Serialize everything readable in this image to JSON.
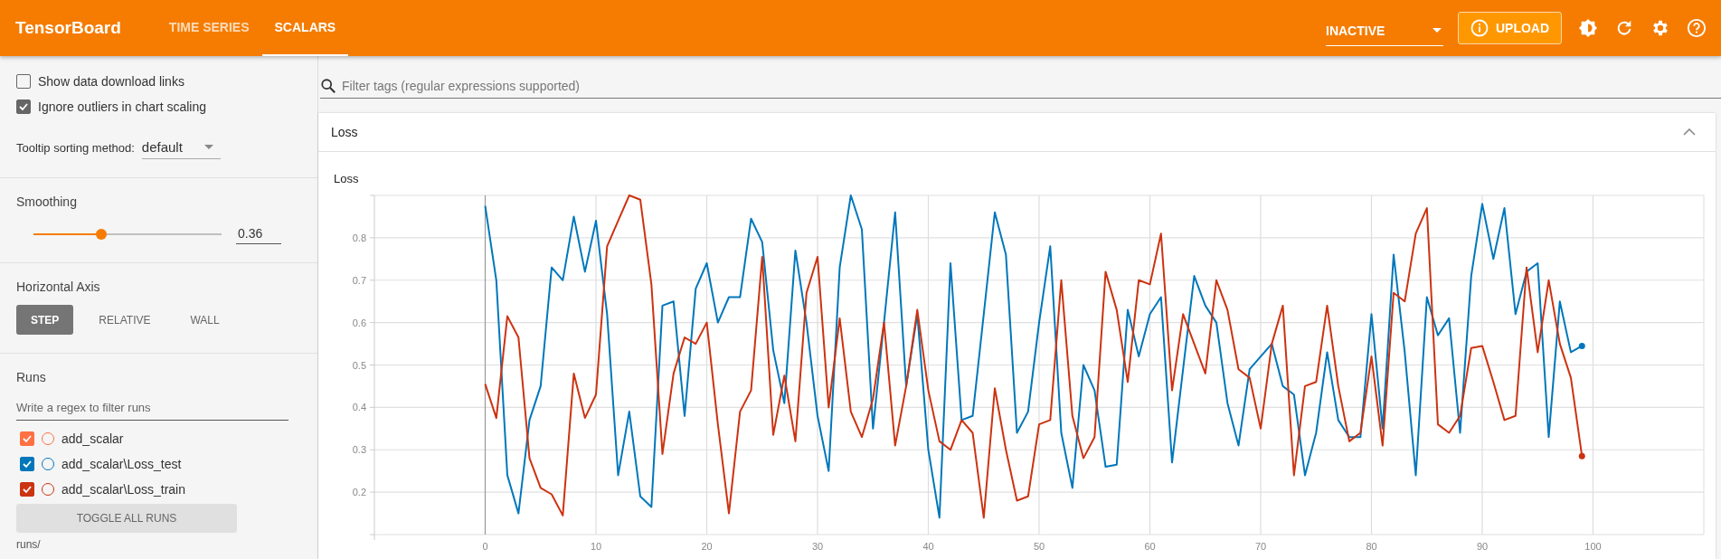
{
  "header": {
    "title": "TensorBoard",
    "tabs": [
      {
        "label": "TIME SERIES",
        "selected": false
      },
      {
        "label": "SCALARS",
        "selected": true
      }
    ],
    "reload_status": "INACTIVE",
    "upload_label": "UPLOAD"
  },
  "sidebar": {
    "options": [
      {
        "label": "Show data download links",
        "checked": false
      },
      {
        "label": "Ignore outliers in chart scaling",
        "checked": true
      }
    ],
    "tooltip_sort": {
      "label": "Tooltip sorting method:",
      "value": "default"
    },
    "smoothing": {
      "label": "Smoothing",
      "level": 0.36,
      "value": "0.36"
    },
    "horizontal_axis": {
      "label": "Horizontal Axis",
      "options": [
        {
          "label": "STEP",
          "selected": true
        },
        {
          "label": "RELATIVE",
          "selected": false
        },
        {
          "label": "WALL",
          "selected": false
        }
      ]
    },
    "runs": {
      "label": "Runs",
      "filter_placeholder": "Write a regex to filter runs",
      "items": [
        {
          "name": "add_scalar",
          "checked": true,
          "color": "#ff7043"
        },
        {
          "name": "add_scalar\\Loss_test",
          "checked": true,
          "color": "#0077bb"
        },
        {
          "name": "add_scalar\\Loss_train",
          "checked": true,
          "color": "#cc3311"
        }
      ],
      "toggle_label": "TOGGLE ALL RUNS",
      "footer": "runs/"
    }
  },
  "main": {
    "filter_placeholder": "Filter tags (regular expressions supported)",
    "card": {
      "title": "Loss",
      "expanded": true,
      "chart_data": {
        "type": "line",
        "title": "Loss",
        "x": [
          0,
          1,
          2,
          3,
          4,
          5,
          6,
          7,
          8,
          9,
          10,
          11,
          12,
          13,
          14,
          15,
          16,
          17,
          18,
          19,
          20,
          21,
          22,
          23,
          24,
          25,
          26,
          27,
          28,
          29,
          30,
          31,
          32,
          33,
          34,
          35,
          36,
          37,
          38,
          39,
          40,
          41,
          42,
          43,
          44,
          45,
          46,
          47,
          48,
          49,
          50,
          51,
          52,
          53,
          54,
          55,
          56,
          57,
          58,
          59,
          60,
          61,
          62,
          63,
          64,
          65,
          66,
          67,
          68,
          69,
          70,
          71,
          72,
          73,
          74,
          75,
          76,
          77,
          78,
          79,
          80,
          81,
          82,
          83,
          84,
          85,
          86,
          87,
          88,
          89,
          90,
          91,
          92,
          93,
          94,
          95,
          96,
          97,
          98,
          99
        ],
        "series": [
          {
            "color": "#0077bb",
            "values": [
              0.875,
              0.7,
              0.24,
              0.15,
              0.37,
              0.45,
              0.73,
              0.7,
              0.85,
              0.72,
              0.84,
              0.62,
              0.24,
              0.39,
              0.19,
              0.165,
              0.64,
              0.65,
              0.38,
              0.68,
              0.74,
              0.6,
              0.66,
              0.66,
              0.845,
              0.79,
              0.535,
              0.41,
              0.77,
              0.6,
              0.38,
              0.25,
              0.73,
              0.9,
              0.82,
              0.35,
              0.6,
              0.86,
              0.45,
              0.62,
              0.3,
              0.14,
              0.74,
              0.37,
              0.38,
              0.62,
              0.86,
              0.76,
              0.34,
              0.39,
              0.6,
              0.78,
              0.34,
              0.21,
              0.5,
              0.44,
              0.26,
              0.265,
              0.63,
              0.52,
              0.62,
              0.66,
              0.27,
              0.49,
              0.71,
              0.64,
              0.6,
              0.41,
              0.31,
              0.49,
              0.52,
              0.55,
              0.45,
              0.43,
              0.24,
              0.34,
              0.53,
              0.37,
              0.33,
              0.33,
              0.62,
              0.35,
              0.76,
              0.53,
              0.24,
              0.66,
              0.57,
              0.61,
              0.34,
              0.71,
              0.88,
              0.75,
              0.87,
              0.62,
              0.72,
              0.74,
              0.33,
              0.65,
              0.53,
              0.545
            ]
          },
          {
            "color": "#cc3311",
            "values": [
              0.455,
              0.375,
              0.615,
              0.565,
              0.28,
              0.21,
              0.195,
              0.145,
              0.48,
              0.375,
              0.43,
              0.78,
              0.84,
              0.9,
              0.89,
              0.69,
              0.29,
              0.48,
              0.565,
              0.55,
              0.6,
              0.36,
              0.15,
              0.39,
              0.44,
              0.755,
              0.335,
              0.475,
              0.32,
              0.67,
              0.755,
              0.4,
              0.61,
              0.39,
              0.33,
              0.42,
              0.6,
              0.31,
              0.45,
              0.63,
              0.44,
              0.32,
              0.3,
              0.37,
              0.34,
              0.14,
              0.445,
              0.3,
              0.18,
              0.19,
              0.36,
              0.37,
              0.7,
              0.38,
              0.28,
              0.33,
              0.72,
              0.63,
              0.46,
              0.7,
              0.69,
              0.81,
              0.44,
              0.62,
              0.55,
              0.48,
              0.7,
              0.63,
              0.49,
              0.47,
              0.35,
              0.55,
              0.64,
              0.24,
              0.45,
              0.46,
              0.64,
              0.45,
              0.32,
              0.34,
              0.52,
              0.31,
              0.67,
              0.65,
              0.81,
              0.87,
              0.36,
              0.34,
              0.38,
              0.54,
              0.545,
              0.46,
              0.37,
              0.38,
              0.73,
              0.53,
              0.7,
              0.55,
              0.47,
              0.285
            ]
          }
        ],
        "grid": true,
        "xlim": [
          -10,
          110
        ],
        "ylim": [
          0.1,
          0.9
        ],
        "xticks": [
          0,
          10,
          20,
          30,
          40,
          50,
          60,
          70,
          80,
          90,
          100
        ],
        "yticks": [
          0.2,
          0.3,
          0.4,
          0.5,
          0.6,
          0.7,
          0.8
        ]
      }
    }
  }
}
